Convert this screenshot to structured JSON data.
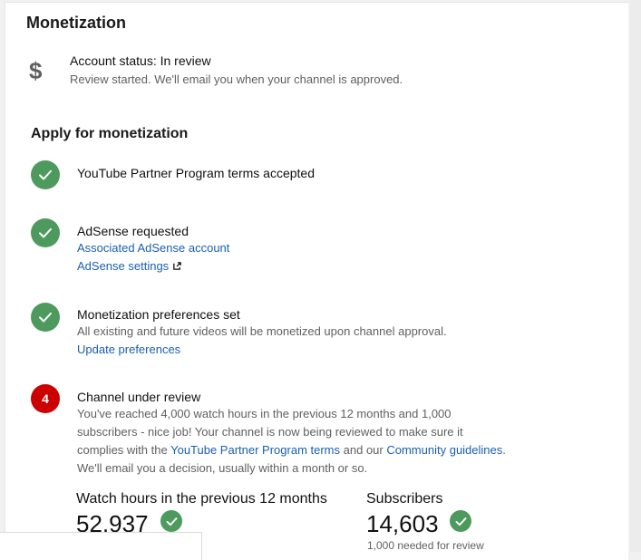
{
  "header": {
    "title": "Monetization"
  },
  "status": {
    "icon": "dollar-icon",
    "symbol": "$",
    "title": "Account status: In review",
    "description": "Review started. We'll email you when your channel is approved."
  },
  "apply": {
    "title": "Apply for monetization",
    "steps": [
      {
        "state": "done",
        "title": "YouTube Partner Program terms accepted"
      },
      {
        "state": "done",
        "title": "AdSense requested",
        "links": [
          "Associated AdSense account",
          "AdSense settings"
        ]
      },
      {
        "state": "done",
        "title": "Monetization preferences set",
        "description": "All existing and future videos will be monetized upon channel approval.",
        "links": [
          "Update preferences"
        ]
      },
      {
        "state": "pending",
        "number": "4",
        "title": "Channel under review",
        "desc_part1": "You've reached 4,000 watch hours in the previous 12 months and 1,000 subscribers - nice job! Your channel is now being reviewed to make sure it complies with the",
        "terms_link": "YouTube Partner Program terms",
        "desc_and": "and our",
        "guidelines_link": "Community guidelines",
        "desc_end": ".",
        "desc_part2": "We'll email you a decision, usually within a month or so."
      }
    ]
  },
  "metrics": {
    "watch": {
      "label": "Watch hours in the previous 12 months",
      "value": "52,937"
    },
    "subscribers": {
      "label": "Subscribers",
      "value": "14,603",
      "note": "1,000 needed for review"
    }
  },
  "colors": {
    "success": "#4e9a5e",
    "pending": "#cc0000",
    "link": "#1a5fb4",
    "secondary_text": "#606060"
  }
}
